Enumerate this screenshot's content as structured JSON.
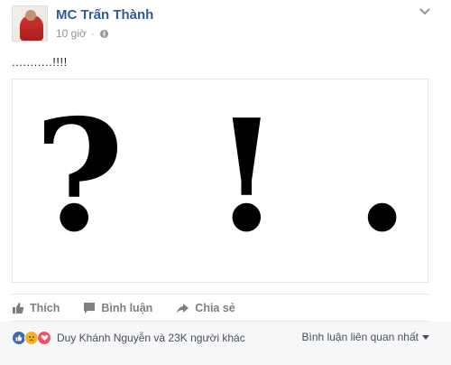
{
  "post": {
    "author": "MC Trấn Thành",
    "time": "10 giờ",
    "separator": "·",
    "text": "...........!!!!",
    "image_glyphs": {
      "question": "?",
      "exclaim": "!",
      "period": "."
    }
  },
  "actions": {
    "like_label": "Thích",
    "comment_label": "Bình luận",
    "share_label": "Chia sẻ"
  },
  "reactions": {
    "summary": "Duy Khánh Nguyễn và 23K người khác",
    "icons": [
      "like-icon",
      "sad-icon",
      "love-icon"
    ]
  },
  "comments": {
    "sort_label": "Bình luận liên quan nhất"
  },
  "colors": {
    "link": "#365899",
    "muted": "#90949c",
    "action": "#7f7f7f",
    "like": "#4267b2",
    "sad": "#f7b125",
    "love": "#f25268"
  }
}
